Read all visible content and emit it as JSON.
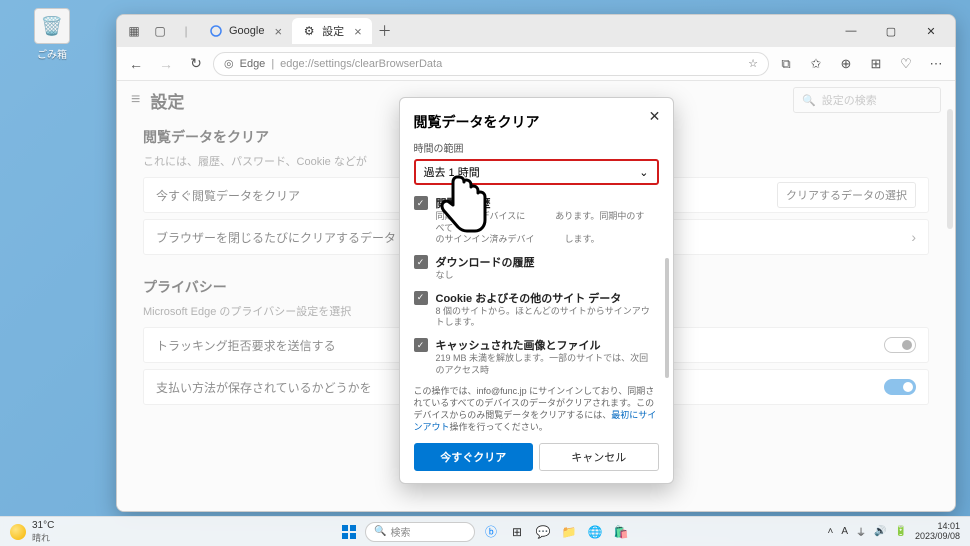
{
  "desktop": {
    "trash_label": "ごみ箱"
  },
  "tabs": {
    "tab1_label": "Google",
    "tab2_label": "設定",
    "close_x": "×",
    "plus": "＋"
  },
  "addr": {
    "scheme": "Edge",
    "sep": "|",
    "url": "edge://settings/clearBrowserData"
  },
  "page": {
    "title": "設定",
    "search_placeholder": "設定の検索",
    "section1_title": "閲覧データをクリア",
    "section1_desc": "これには、履歴、パスワード、Cookie などが",
    "row1_label": "今すぐ閲覧データをクリア",
    "row1_btn": "クリアするデータの選択",
    "row2_label": "ブラウザーを閉じるたびにクリアするデータ",
    "section2_title": "プライバシー",
    "section2_desc": "Microsoft Edge のプライバシー設定を選択",
    "row3_label": "トラッキング拒否要求を送信する",
    "row4_label": "支払い方法が保存されているかどうかを"
  },
  "dialog": {
    "title": "閲覧データをクリア",
    "range_label": "時間の範囲",
    "range_value": "過去 1 時間",
    "item1_title": "閲覧の履歴",
    "item1_sub_a": "同期されたデバイスに",
    "item1_sub_b": "あります。同期中のすべて",
    "item1_sub_c": "のサインイン済みデバイ",
    "item1_sub_d": "します。",
    "item2_title": "ダウンロードの履歴",
    "item2_sub": "なし",
    "item3_title": "Cookie およびその他のサイト データ",
    "item3_sub": "8 個のサイトから。ほとんどのサイトからサインアウトします。",
    "item4_title": "キャッシュされた画像とファイル",
    "item4_sub": "219 MB 未満を解放します。一部のサイトでは、次回のアクセス時",
    "note_a": "この操作では、info@func.jp にサインインしており、同期されているすべてのデバイスのデータがクリアされます。このデバイスからのみ閲覧データをクリアするには、",
    "note_link": "最初にサインアウト",
    "note_b": "操作を行ってください。",
    "btn_clear": "今すぐクリア",
    "btn_cancel": "キャンセル"
  },
  "taskbar": {
    "temp": "31°C",
    "weather": "晴れ",
    "search": "検索",
    "ime": "A",
    "time": "14:01",
    "date": "2023/09/08"
  }
}
